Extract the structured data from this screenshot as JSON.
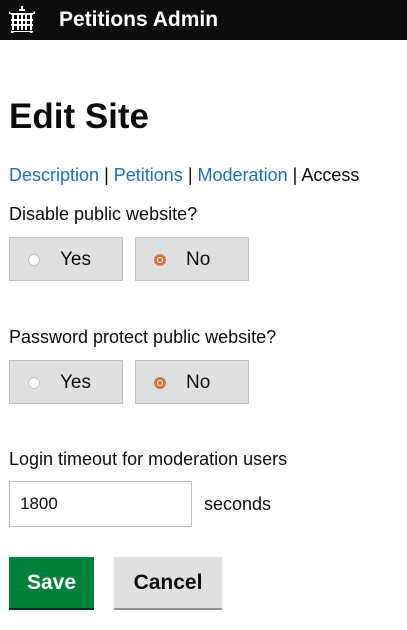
{
  "header": {
    "title": "Petitions Admin",
    "logo_icon": "portcullis-icon",
    "background": "#0b0c0c"
  },
  "page": {
    "title": "Edit Site"
  },
  "subnav": {
    "items": [
      {
        "label": "Description",
        "link": true
      },
      {
        "label": "Petitions",
        "link": true
      },
      {
        "label": "Moderation",
        "link": true
      },
      {
        "label": "Access",
        "link": false,
        "current": true
      }
    ],
    "separator": "|"
  },
  "form": {
    "disable_public": {
      "label": "Disable public website?",
      "options": [
        "Yes",
        "No"
      ],
      "selected": "No"
    },
    "password_protect": {
      "label": "Password protect public website?",
      "options": [
        "Yes",
        "No"
      ],
      "selected": "No"
    },
    "login_timeout": {
      "label": "Login timeout for moderation users",
      "value": "1800",
      "unit": "seconds"
    }
  },
  "actions": {
    "save_label": "Save",
    "cancel_label": "Cancel"
  },
  "colors": {
    "link": "#1d70b8",
    "save": "#00823b",
    "radio_selected": "#d4733a",
    "radio_bg": "#dee0e2"
  }
}
